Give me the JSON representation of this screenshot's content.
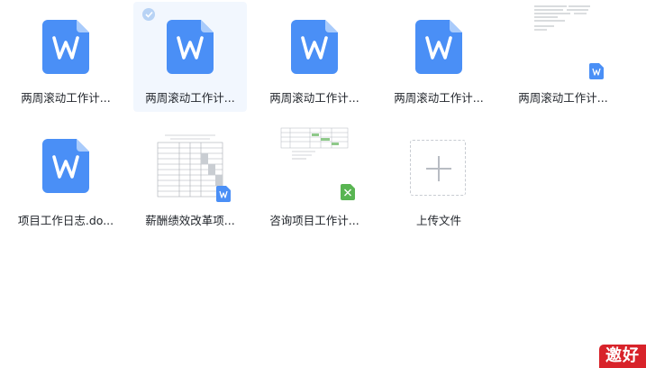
{
  "files": [
    {
      "name": "两周滚动工作计...",
      "type": "word",
      "selected": false
    },
    {
      "name": "两周滚动工作计...",
      "type": "word",
      "selected": true
    },
    {
      "name": "两周滚动工作计...",
      "type": "word",
      "selected": false
    },
    {
      "name": "两周滚动工作计...",
      "type": "word",
      "selected": false
    },
    {
      "name": "两周滚动工作计...",
      "type": "word-preview",
      "selected": false
    },
    {
      "name": "项目工作日志.do...",
      "type": "word",
      "selected": false
    },
    {
      "name": "薪酬绩效改革项...",
      "type": "word-preview",
      "selected": false
    },
    {
      "name": "咨询项目工作计...",
      "type": "excel-preview",
      "selected": false
    }
  ],
  "upload": {
    "label": "上传文件"
  },
  "brand": {
    "text": "邀好"
  },
  "colors": {
    "word_blue": "#4a8ff6",
    "excel_green": "#59b552",
    "selected_bg": "#f2f7fe",
    "check_blue": "#b8d3f5"
  }
}
